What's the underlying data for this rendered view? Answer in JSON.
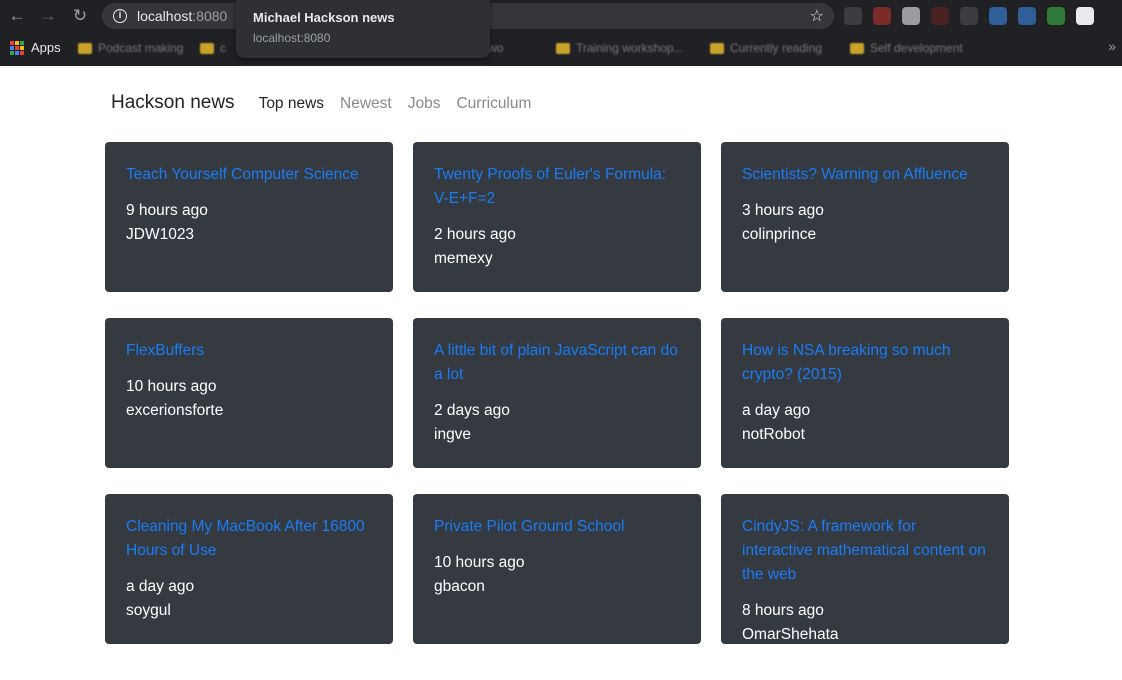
{
  "browser": {
    "url_host": "localhost",
    "url_port": ":8080",
    "apps_label": "Apps",
    "bookmarks": [
      "Podcast making",
      "c",
      "e wo",
      "Training workshop...",
      "Currently reading",
      "Self development"
    ],
    "more": "»",
    "tooltip": {
      "title": "Michael Hackson news",
      "url": "localhost:8080"
    }
  },
  "nav": {
    "brand": "Hackson news",
    "links": [
      "Top news",
      "Newest",
      "Jobs",
      "Curriculum"
    ]
  },
  "stories": [
    {
      "title": "Teach Yourself Computer Science",
      "time": "9 hours ago",
      "author": "JDW1023"
    },
    {
      "title": "Twenty Proofs of Euler's Formula: V-E+F=2",
      "time": "2 hours ago",
      "author": "memexy"
    },
    {
      "title": "Scientists? Warning on Affluence",
      "time": "3 hours ago",
      "author": "colinprince"
    },
    {
      "title": "FlexBuffers",
      "time": "10 hours ago",
      "author": "excerionsforte"
    },
    {
      "title": "A little bit of plain JavaScript can do a lot",
      "time": "2 days ago",
      "author": "ingve"
    },
    {
      "title": "How is NSA breaking so much crypto? (2015)",
      "time": "a day ago",
      "author": "notRobot"
    },
    {
      "title": "Cleaning My MacBook After 16800 Hours of Use",
      "time": "a day ago",
      "author": "soygul"
    },
    {
      "title": "Private Pilot Ground School",
      "time": "10 hours ago",
      "author": "gbacon"
    },
    {
      "title": "CindyJS: A framework for interactive mathematical content on the web",
      "time": "8 hours ago",
      "author": "OmarShehata"
    }
  ]
}
